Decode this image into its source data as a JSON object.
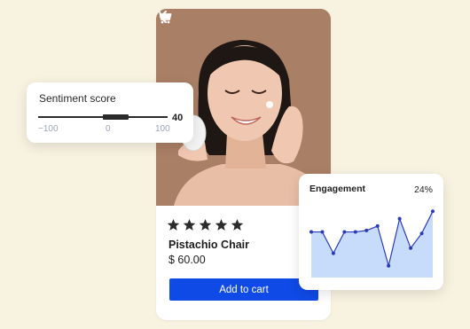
{
  "product": {
    "photo_alt": "",
    "rating": 5,
    "rating_max": 5,
    "name": "Pistachio Chair",
    "price": "$ 60.00",
    "cta_label": "Add to cart"
  },
  "nav": {
    "back_icon": "chevron-left-icon",
    "cart_icon": "shopping-cart-icon"
  },
  "sentiment": {
    "title": "Sentiment score",
    "value": "40",
    "min_label": "−100",
    "mid_label": "0",
    "max_label": "100",
    "min": -100,
    "max": 100,
    "score": 40
  },
  "engagement": {
    "title": "Engagement",
    "percent": "24%",
    "series": [
      0.62,
      0.62,
      0.33,
      0.62,
      0.62,
      0.64,
      0.7,
      0.16,
      0.8,
      0.4,
      0.6,
      0.9
    ],
    "colors": {
      "line": "#2a3bb8",
      "fill": "#c7dcfb"
    }
  },
  "colors": {
    "background": "#f8f2e1",
    "accent": "#0f4ae6",
    "star": "#2b2b2b"
  }
}
